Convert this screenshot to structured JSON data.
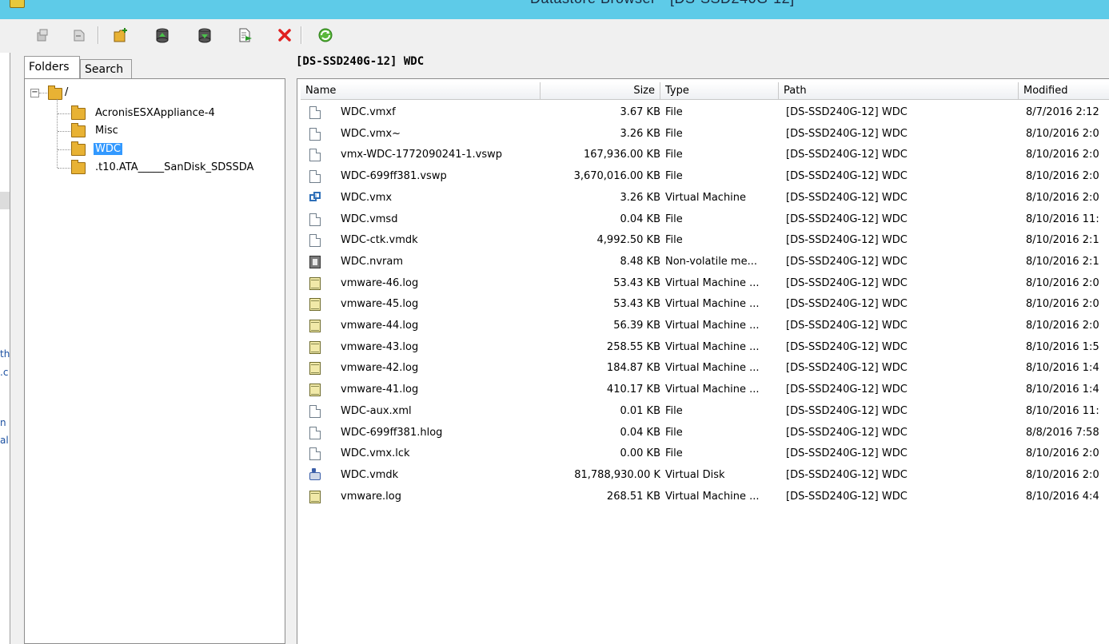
{
  "window": {
    "title": "Datastore Browser - [DS-SSD240G-12]"
  },
  "toolbar": {
    "buttons": [
      {
        "name": "browse-datastore-icon"
      },
      {
        "name": "move-icon"
      },
      {
        "name": "new-folder-icon"
      },
      {
        "name": "upload-icon"
      },
      {
        "name": "download-icon"
      },
      {
        "name": "register-vm-icon"
      },
      {
        "name": "delete-icon"
      },
      {
        "name": "refresh-icon"
      }
    ]
  },
  "tabs": {
    "folders": "Folders",
    "search": "Search"
  },
  "tree": {
    "root": "/",
    "root_expander": "−",
    "items": [
      {
        "label": "AcronisESXAppliance-4"
      },
      {
        "label": "Misc"
      },
      {
        "label": "WDC",
        "selected": true
      },
      {
        "label": ".t10.ATA_____SanDisk_SDSSDA"
      }
    ]
  },
  "main": {
    "current_path": "[DS-SSD240G-12] WDC",
    "columns": {
      "name": "Name",
      "size": "Size",
      "type": "Type",
      "path": "Path",
      "modified": "Modified"
    },
    "rows": [
      {
        "icon": "file",
        "name": "WDC.vmxf",
        "size": "3.67 KB",
        "type": "File",
        "path": "[DS-SSD240G-12] WDC",
        "modified": "8/7/2016 2:12"
      },
      {
        "icon": "file",
        "name": "WDC.vmx~",
        "size": "3.26 KB",
        "type": "File",
        "path": "[DS-SSD240G-12] WDC",
        "modified": "8/10/2016 2:0"
      },
      {
        "icon": "file",
        "name": "vmx-WDC-1772090241-1.vswp",
        "size": "167,936.00 KB",
        "type": "File",
        "path": "[DS-SSD240G-12] WDC",
        "modified": "8/10/2016 2:0"
      },
      {
        "icon": "file",
        "name": "WDC-699ff381.vswp",
        "size": "3,670,016.00 KB",
        "type": "File",
        "path": "[DS-SSD240G-12] WDC",
        "modified": "8/10/2016 2:0"
      },
      {
        "icon": "vm",
        "name": "WDC.vmx",
        "size": "3.26 KB",
        "type": "Virtual Machine",
        "path": "[DS-SSD240G-12] WDC",
        "modified": "8/10/2016 2:0"
      },
      {
        "icon": "file",
        "name": "WDC.vmsd",
        "size": "0.04 KB",
        "type": "File",
        "path": "[DS-SSD240G-12] WDC",
        "modified": "8/10/2016 11:"
      },
      {
        "icon": "file",
        "name": "WDC-ctk.vmdk",
        "size": "4,992.50 KB",
        "type": "File",
        "path": "[DS-SSD240G-12] WDC",
        "modified": "8/10/2016 2:1"
      },
      {
        "icon": "nvram",
        "name": "WDC.nvram",
        "size": "8.48 KB",
        "type": "Non-volatile me...",
        "path": "[DS-SSD240G-12] WDC",
        "modified": "8/10/2016 2:1"
      },
      {
        "icon": "log",
        "name": "vmware-46.log",
        "size": "53.43 KB",
        "type": "Virtual Machine ...",
        "path": "[DS-SSD240G-12] WDC",
        "modified": "8/10/2016 2:0"
      },
      {
        "icon": "log",
        "name": "vmware-45.log",
        "size": "53.43 KB",
        "type": "Virtual Machine ...",
        "path": "[DS-SSD240G-12] WDC",
        "modified": "8/10/2016 2:0"
      },
      {
        "icon": "log",
        "name": "vmware-44.log",
        "size": "56.39 KB",
        "type": "Virtual Machine ...",
        "path": "[DS-SSD240G-12] WDC",
        "modified": "8/10/2016 2:0"
      },
      {
        "icon": "log",
        "name": "vmware-43.log",
        "size": "258.55 KB",
        "type": "Virtual Machine ...",
        "path": "[DS-SSD240G-12] WDC",
        "modified": "8/10/2016 1:5"
      },
      {
        "icon": "log",
        "name": "vmware-42.log",
        "size": "184.87 KB",
        "type": "Virtual Machine ...",
        "path": "[DS-SSD240G-12] WDC",
        "modified": "8/10/2016 1:4"
      },
      {
        "icon": "log",
        "name": "vmware-41.log",
        "size": "410.17 KB",
        "type": "Virtual Machine ...",
        "path": "[DS-SSD240G-12] WDC",
        "modified": "8/10/2016 1:4"
      },
      {
        "icon": "file",
        "name": "WDC-aux.xml",
        "size": "0.01 KB",
        "type": "File",
        "path": "[DS-SSD240G-12] WDC",
        "modified": "8/10/2016 11:"
      },
      {
        "icon": "file",
        "name": "WDC-699ff381.hlog",
        "size": "0.04 KB",
        "type": "File",
        "path": "[DS-SSD240G-12] WDC",
        "modified": "8/8/2016 7:58"
      },
      {
        "icon": "file",
        "name": "WDC.vmx.lck",
        "size": "0.00 KB",
        "type": "File",
        "path": "[DS-SSD240G-12] WDC",
        "modified": "8/10/2016 2:0"
      },
      {
        "icon": "disk",
        "name": "WDC.vmdk",
        "size": "81,788,930.00 K",
        "type": "Virtual Disk",
        "path": "[DS-SSD240G-12] WDC",
        "modified": "8/10/2016 2:0"
      },
      {
        "icon": "log",
        "name": "vmware.log",
        "size": "268.51 KB",
        "type": "Virtual Machine ...",
        "path": "[DS-SSD240G-12] WDC",
        "modified": "8/10/2016 4:4"
      }
    ]
  },
  "left_fragment": {
    "lines": [
      "th",
      ".c",
      "n",
      "al"
    ]
  },
  "colors": {
    "titlebar": "#5ecbe8",
    "selection": "#3399ff",
    "delete_red": "#e02020",
    "refresh_green": "#3a9a2a"
  }
}
